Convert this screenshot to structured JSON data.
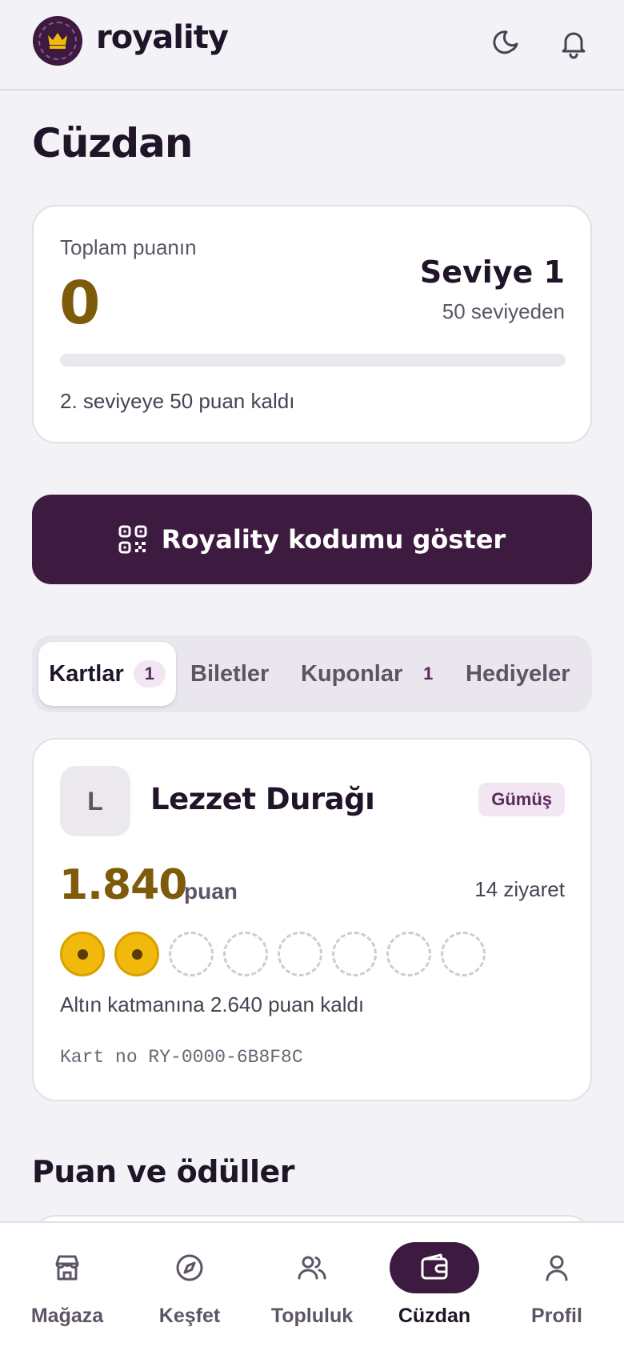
{
  "colors": {
    "brand": "#3d1a3f",
    "points": "#7d5b0a",
    "stamp_on": "#f0b90b",
    "background": "#f3f2f6"
  },
  "header": {
    "brand": "royality",
    "logo_icon": "crown-icon",
    "theme_icon": "moon-icon",
    "notifications_icon": "bell-icon"
  },
  "page": {
    "title": "Cüzdan"
  },
  "points_card": {
    "label": "Toplam puanın",
    "value": "0",
    "level": "Seviye 1",
    "level_sub": "50 seviyeden",
    "progress": 0,
    "remaining": "2. seviyeye 50 puan kaldı"
  },
  "cta": {
    "label": "Royality kodumu göster",
    "icon": "qr-code-icon"
  },
  "tabs": [
    {
      "label": "Kartlar",
      "count": "1",
      "active": true
    },
    {
      "label": "Biletler",
      "count": ""
    },
    {
      "label": "Kuponlar",
      "count": "1"
    },
    {
      "label": "Hediyeler",
      "count": ""
    }
  ],
  "loyalty_card": {
    "avatar_letter": "L",
    "name": "Lezzet Durağı",
    "tier": "Gümüş",
    "points": "1.840",
    "points_unit": "puan",
    "visits": "14 ziyaret",
    "stamps_filled": 2,
    "stamps_total": 8,
    "next_tier": "Altın katmanına 2.640 puan kaldı",
    "card_no": "Kart no RY-0000-6B8F8C"
  },
  "section": {
    "title": "Puan ve ödüller"
  },
  "bottom_nav": [
    {
      "label": "Mağaza",
      "icon": "store-icon"
    },
    {
      "label": "Keşfet",
      "icon": "compass-icon"
    },
    {
      "label": "Topluluk",
      "icon": "users-icon"
    },
    {
      "label": "Cüzdan",
      "icon": "wallet-icon",
      "active": true
    },
    {
      "label": "Profil",
      "icon": "user-icon"
    }
  ]
}
